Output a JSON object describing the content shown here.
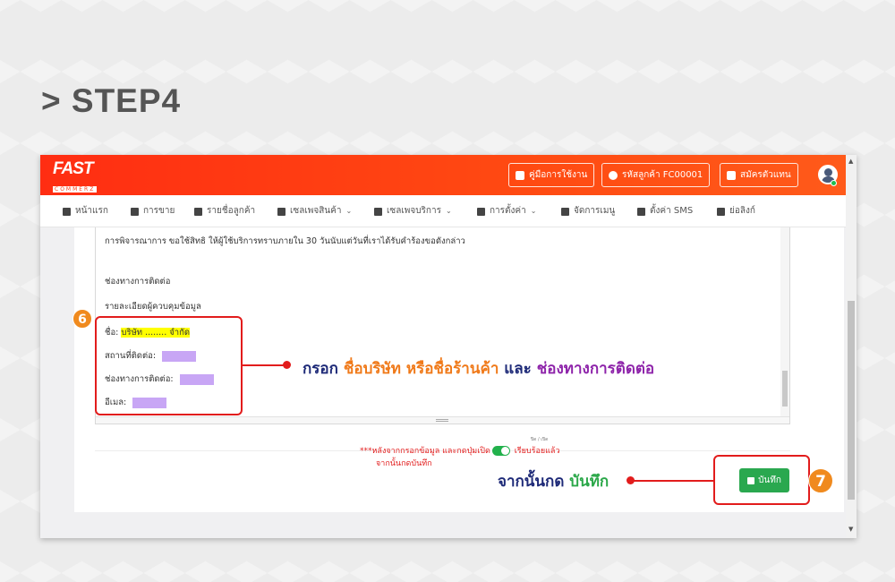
{
  "step_title": "> STEP4",
  "app": {
    "logo_main": "FAST",
    "logo_sub": "COMMERZ",
    "header_buttons": {
      "manual": "คู่มือการใช้งาน",
      "customer_code": "รหัสลูกค้า FC00001",
      "register_agent": "สมัครตัวแทน"
    },
    "nav": [
      {
        "label": "หน้าแรก",
        "icon": "home-icon"
      },
      {
        "label": "การขาย",
        "icon": "sales-icon"
      },
      {
        "label": "รายชื่อลูกค้า",
        "icon": "user-icon"
      },
      {
        "label": "เซลเพจสินค้า",
        "icon": "box-icon",
        "caret": "⌄"
      },
      {
        "label": "เซลเพจบริการ",
        "icon": "bell-icon",
        "caret": "⌄"
      },
      {
        "label": "การตั้งค่า",
        "icon": "gear-icon",
        "caret": "⌄"
      },
      {
        "label": "จัดการเมนู",
        "icon": "menu-icon"
      },
      {
        "label": "ตั้งค่า SMS",
        "icon": "chat-icon"
      },
      {
        "label": "ย่อลิงก์",
        "icon": "file-icon"
      }
    ]
  },
  "editor": {
    "line1": "การพิจารณาการ ขอใช้สิทธิ ให้ผู้ใช้บริการทราบภายใน 30 วันนับแต่วันที่เราได้รับคำร้องขอดังกล่าว",
    "contact_heading": "ช่องทางการติดต่อ",
    "controller_heading": "รายละเอียดผู้ควบคุมข้อมูล",
    "name_label": "ชื่อ: ",
    "name_value": "บริษัท ........ จำกัด",
    "place_label": "สถานที่ติดต่อ: ",
    "channel_label": "ช่องทางการติดต่อ: ",
    "email_label": "อีเมล: "
  },
  "annotations": {
    "badge6": "6",
    "badge7": "7",
    "instr1": {
      "p1": "กรอก ",
      "p2": "ชื่อบริษัท หรือชื่อร้านค้า",
      "p3": " และ ",
      "p4": "ช่องทางการติดต่อ"
    },
    "note_line1_a": "***หลังจากกรอกข้อมูล และกดปุ่มเปิด",
    "note_line1_b": " เรียบร้อยแล้ว",
    "note_line2": "จากนั้นกดบันทึก",
    "toggle_caption": "ปิด / เปิด",
    "instr2": {
      "p1": "จากนั้นกด ",
      "p2": "บันทึก"
    }
  },
  "save_button_label": "บันทึก",
  "colors": {
    "header_red": "#ff2d12",
    "annotation_red": "#e21c1c",
    "badge_orange": "#f08a1e",
    "save_green": "#2aa84f",
    "highlight_yellow": "#ffff00",
    "redacted_purple": "#c8a6f5"
  }
}
